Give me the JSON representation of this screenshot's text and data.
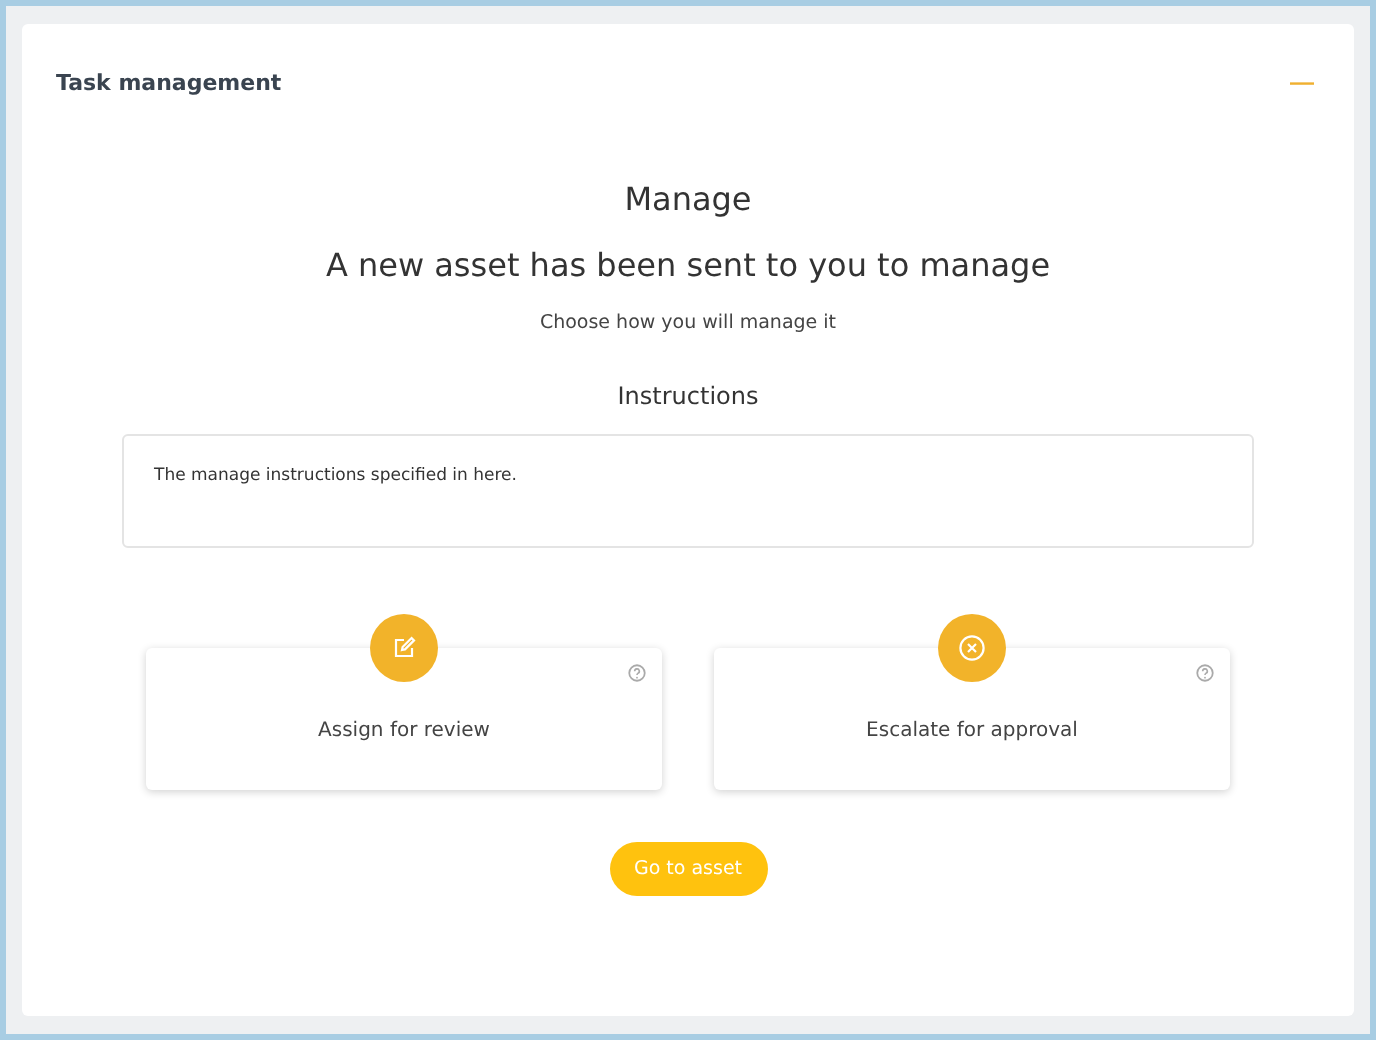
{
  "panel": {
    "title": "Task management",
    "collapse_icon": "—"
  },
  "heading": "Manage",
  "headline": "A new asset has been sent to you to manage",
  "subtitle": "Choose how you will manage it",
  "instructions": {
    "label": "Instructions",
    "text": "The manage instructions specified in here."
  },
  "options": [
    {
      "kind": "edit",
      "label": "Assign for review"
    },
    {
      "kind": "cancel",
      "label": "Escalate for approval"
    }
  ],
  "action_button": "Go to asset"
}
